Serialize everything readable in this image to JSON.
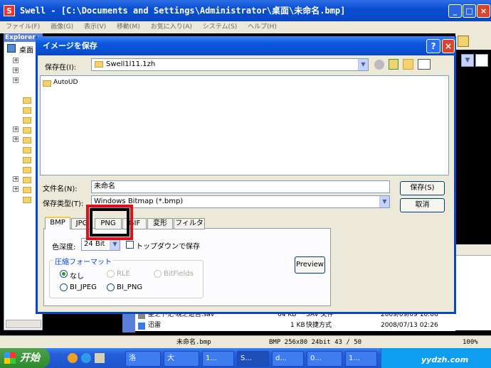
{
  "main_window": {
    "title": "Swell - [C:\\Documents and Settings\\Administrator\\桌面\\未命名.bmp]",
    "app_icon": "S",
    "menu": [
      "ファイル(F)",
      "画像(G)",
      "表示(V)",
      "移動(M)",
      "お気に入り(A)",
      "システム(S)",
      "ヘルプ(H)"
    ],
    "explorer_header": "Explorer",
    "explorer_root": "桌面",
    "minimize": "_",
    "maximize": "□",
    "close": "×"
  },
  "dialog": {
    "title": "イメージを保存",
    "help": "?",
    "close": "×",
    "save_in_label": "保存在(I):",
    "save_in_value": "Swell1l11.1zh",
    "folder_items": [
      "AutoUD"
    ],
    "filename_label": "文件名(N):",
    "filename_value": "未命名",
    "filetype_label": "保存类型(T):",
    "filetype_value": "Windows Bitmap (*.bmp)",
    "save_button": "保存(S)",
    "cancel_button": "取消",
    "tabs": [
      "BMP",
      "JPG",
      "PNG",
      "GIF",
      "変形",
      "フィルタ"
    ],
    "active_tab": "BMP",
    "depth_label": "色深度:",
    "depth_value": "24 Bit",
    "topdown_label": "トップダウンで保存",
    "compression_legend": "圧縮フォーマット",
    "compression_options": [
      "なし",
      "RLE",
      "BitFields",
      "BI_JPEG",
      "BI_PNG"
    ],
    "compression_selected": "なし",
    "preview_button": "Preview"
  },
  "file_list": [
    {
      "name": "星之卜记·晚之遊吉.sav",
      "size": "64 KB",
      "type": "SAV 文件",
      "date": "2009/09/09 10:06"
    },
    {
      "name": "迅雷",
      "size": "1 KB",
      "type": "快捷方式",
      "date": "2008/07/13 02:26"
    }
  ],
  "statusbar": {
    "filename": "未命名.bmp",
    "info": "BMP 256x80 24bit 43 / 50",
    "zoom": "100%"
  },
  "taskbar": {
    "start": "开始",
    "tasks": [
      "洛",
      "大",
      "1...",
      "S...",
      "d...",
      "0...",
      "1..."
    ],
    "watermark": "yydzh.com"
  },
  "colors": {
    "highlight_box": "#e0101a",
    "accent": "#0846c4"
  }
}
